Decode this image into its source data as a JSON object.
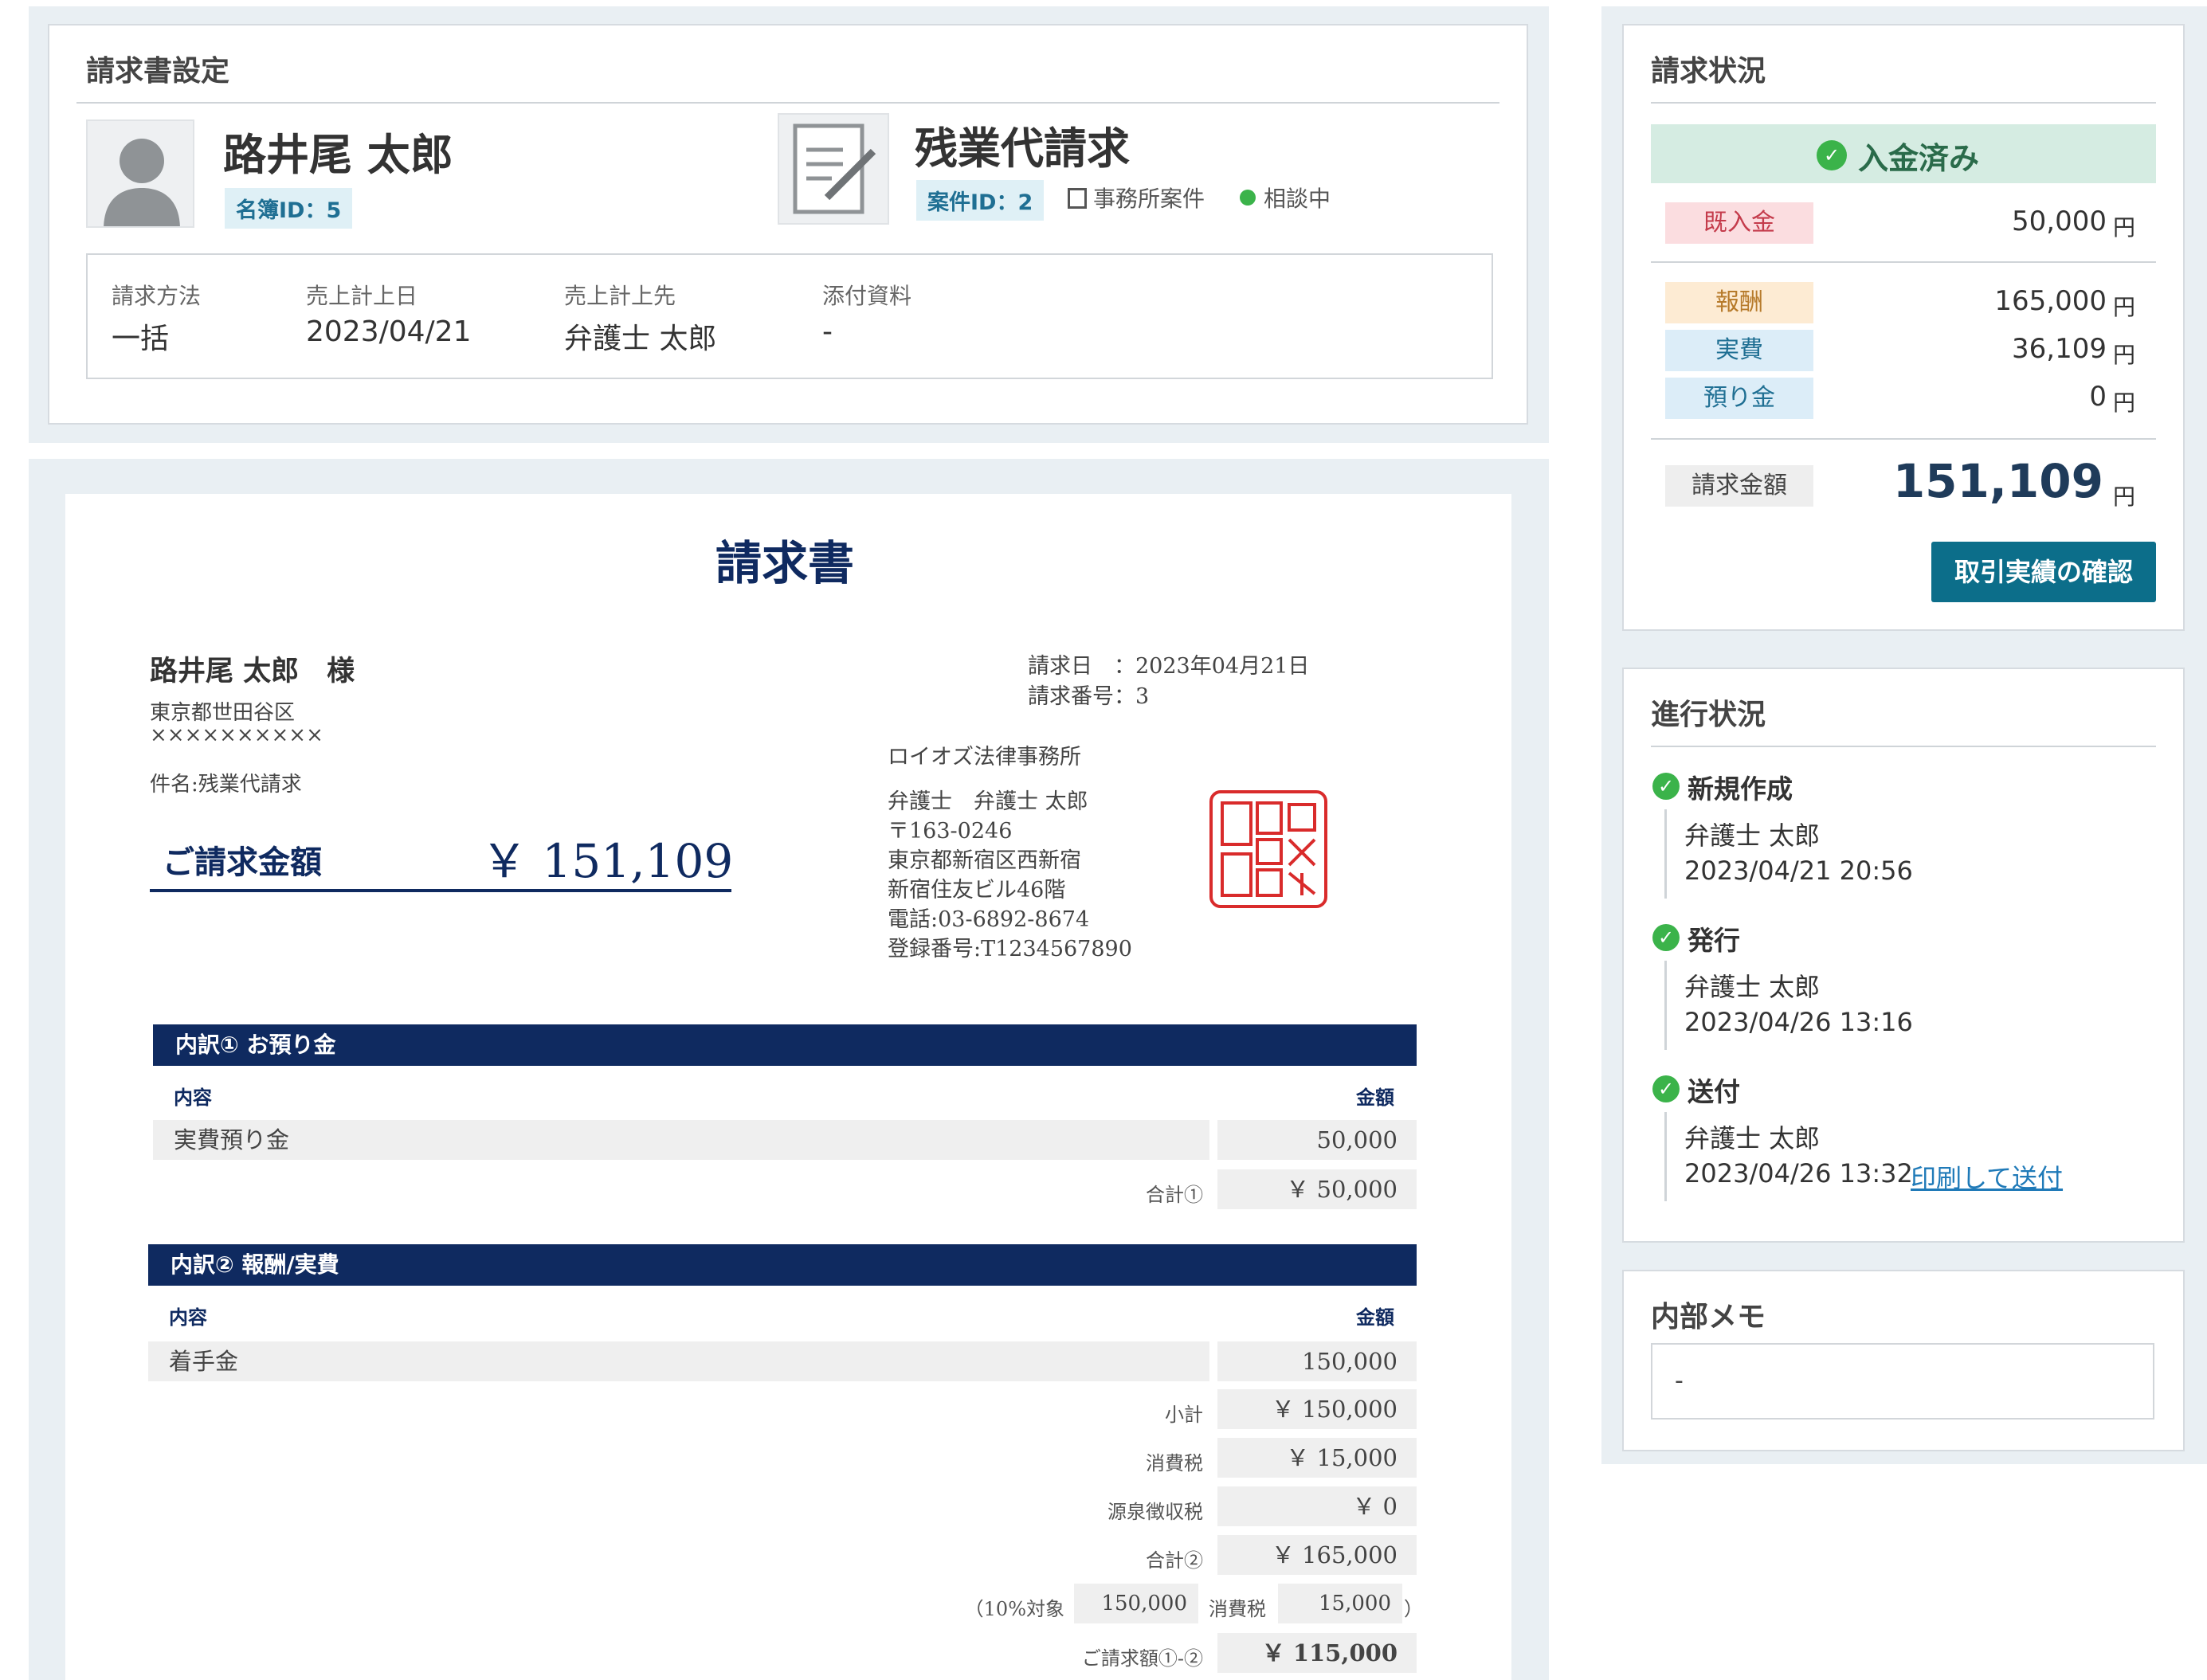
{
  "settings": {
    "title": "請求書設定",
    "client_name": "路井尾 太郎",
    "roster_id": "名簿ID：5",
    "matter_title": "残業代請求",
    "matter_id": "案件ID：2",
    "matter_type": "事務所案件",
    "matter_status": "相談中",
    "status_dot_color": "#3bb34a",
    "fields": [
      {
        "label": "請求方法",
        "value": "一括"
      },
      {
        "label": "売上計上日",
        "value": "2023/04/21"
      },
      {
        "label": "売上計上先",
        "value": "弁護士 太郎"
      },
      {
        "label": "添付資料",
        "value": "-"
      }
    ]
  },
  "invoice": {
    "title": "請求書",
    "addressee": "路井尾 太郎　様",
    "address1": "東京都世田谷区",
    "address2": "××××××××××",
    "subject": "件名:残業代請求",
    "amount_label": "ご請求金額",
    "amount_value": "￥ 151,109",
    "date_label": "請求日　：2023年04月21日",
    "number_label": "請求番号：3",
    "firm_name": "ロイオズ法律事務所",
    "firm_lines": [
      "弁護士　弁護士 太郎",
      "〒163-0246",
      "東京都新宿区西新宿",
      "新宿住友ビル46階",
      "電話:03-6892-8674",
      "登録番号:T1234567890"
    ],
    "seal_text": "ロイオズ法律事務所",
    "section1": {
      "title": "内訳① お預り金",
      "col_content": "内容",
      "col_amount": "金額",
      "rows": [
        {
          "label": "実費預り金",
          "amount": "50,000"
        }
      ],
      "total_label": "合計①",
      "total_value": "￥ 50,000"
    },
    "section2": {
      "title": "内訳② 報酬/実費",
      "col_content": "内容",
      "col_amount": "金額",
      "rows": [
        {
          "label": "着手金",
          "amount": "150,000"
        }
      ],
      "subtotal_label": "小計",
      "subtotal_value": "￥ 150,000",
      "tax_label": "消費税",
      "tax_value": "￥ 15,000",
      "withholding_label": "源泉徴収税",
      "withholding_value": "￥ 0",
      "total_label": "合計②",
      "total_value": "￥ 165,000",
      "tax_open": "（10%対象",
      "taxable_value": "150,000",
      "tax_small_label": "消費税",
      "tax_small_value": "15,000",
      "tax_close": "）",
      "grand_label": "ご請求額①-②",
      "grand_value": "￥ 115,000"
    },
    "navy_color": "#0f2a60"
  },
  "billing": {
    "title": "請求状況",
    "paid_banner": "入金済み",
    "paid_icon": "check-circle-icon",
    "received_label": "既入金",
    "received_value": "50,000",
    "fee_label": "報酬",
    "fee_value": "165,000",
    "expense_label": "実費",
    "expense_value": "36,109",
    "deposit_label": "預り金",
    "deposit_value": "0",
    "invoice_total_label": "請求金額",
    "invoice_total_value": "151,109",
    "yen": "円",
    "confirm_button": "取引実績の確認",
    "accent_color": "#0c6e8a"
  },
  "progress": {
    "title": "進行状況",
    "steps": [
      {
        "title": "新規作成",
        "user": "弁護士 太郎",
        "time": "2023/04/21 20:56"
      },
      {
        "title": "発行",
        "user": "弁護士 太郎",
        "time": "2023/04/26 13:16"
      },
      {
        "title": "送付",
        "user": "弁護士 太郎",
        "time": "2023/04/26 13:32",
        "link": "印刷して送付"
      }
    ]
  },
  "memo": {
    "title": "内部メモ",
    "value": "-"
  }
}
